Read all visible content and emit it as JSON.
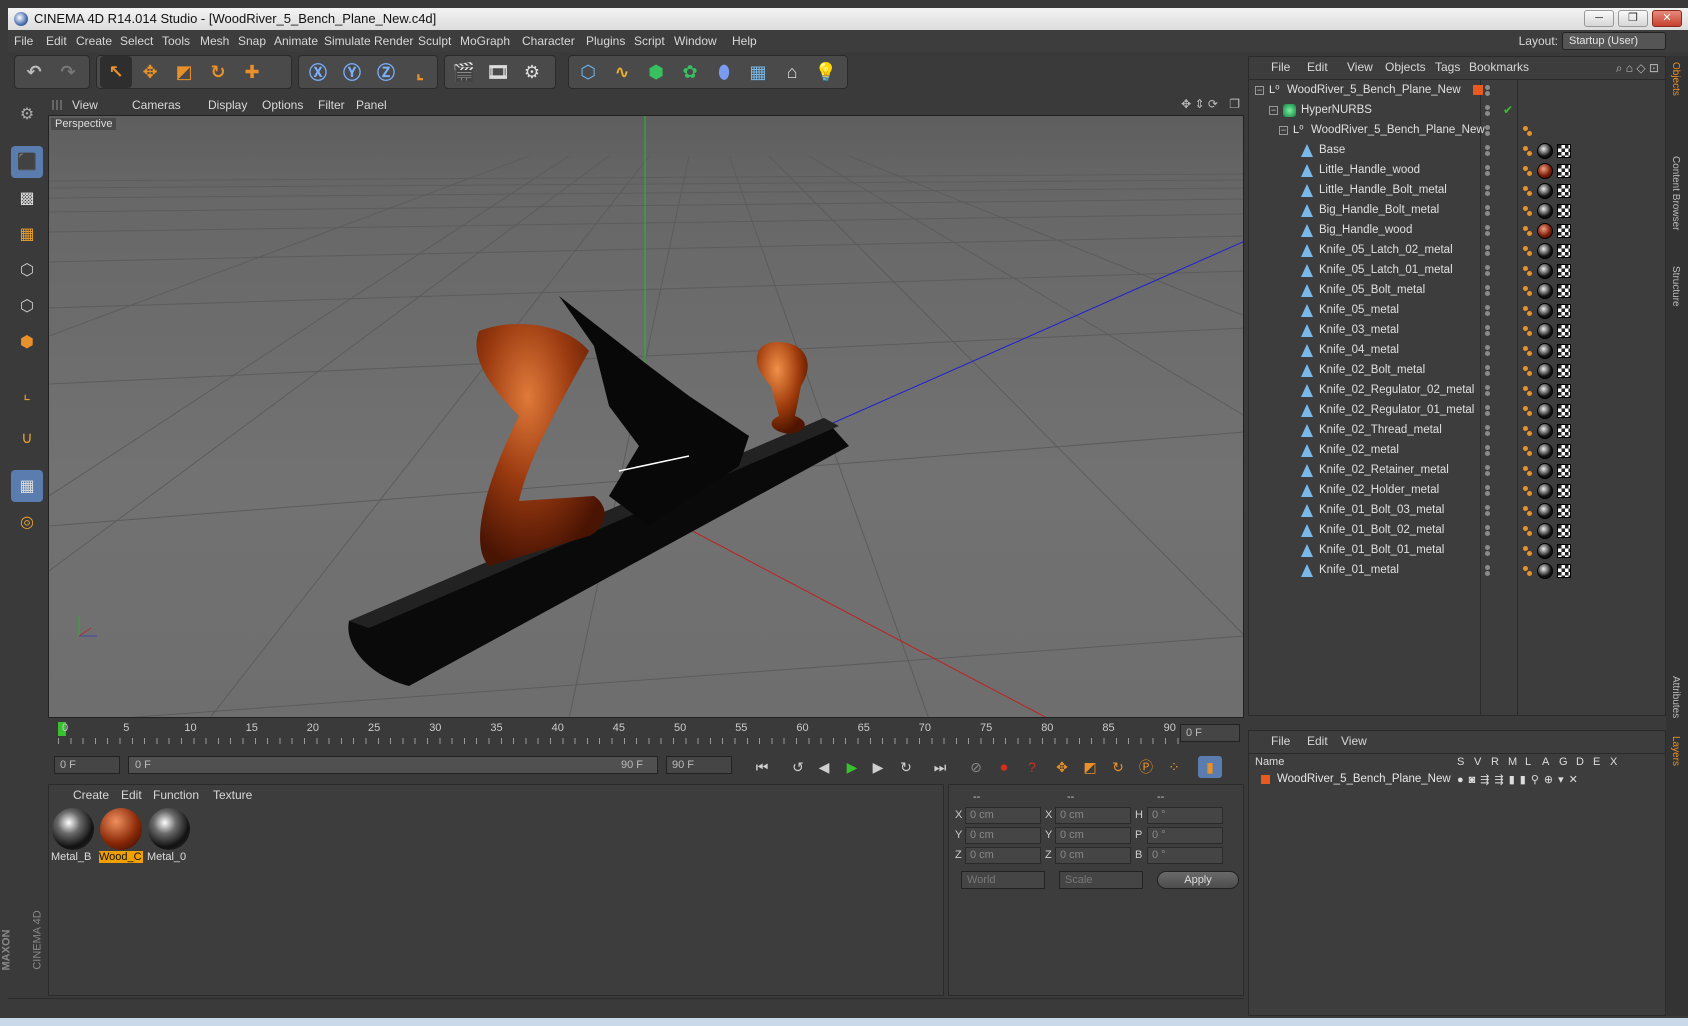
{
  "window": {
    "title": "CINEMA 4D R14.014 Studio - [WoodRiver_5_Bench_Plane_New.c4d]",
    "min": "─",
    "restore": "❐",
    "close": "✕"
  },
  "menubar": {
    "items": [
      "File",
      "Edit",
      "Create",
      "Select",
      "Tools",
      "Mesh",
      "Snap",
      "Animate",
      "Simulate",
      "Render",
      "Sculpt",
      "MoGraph",
      "Character",
      "Plugins",
      "Script",
      "Window",
      "Help"
    ],
    "layout_label": "Layout:",
    "layout_value": "Startup (User)"
  },
  "viewport": {
    "menu": [
      "View",
      "Cameras",
      "Display",
      "Options",
      "Filter",
      "Panel"
    ],
    "label": "Perspective"
  },
  "timeline": {
    "ticks": [
      "0",
      "5",
      "10",
      "15",
      "20",
      "25",
      "30",
      "35",
      "40",
      "45",
      "50",
      "55",
      "60",
      "65",
      "70",
      "75",
      "80",
      "85",
      "90"
    ],
    "current_frame": "0 F"
  },
  "transport": {
    "start": "0 F",
    "range_start": "0 F",
    "range_end": "90 F",
    "end": "90 F"
  },
  "materials": {
    "menu": [
      "Create",
      "Edit",
      "Function",
      "Texture"
    ],
    "items": [
      {
        "label": "Metal_B",
        "kind": "metal"
      },
      {
        "label": "Wood_C",
        "kind": "wood",
        "selected": true
      },
      {
        "label": "Metal_0",
        "kind": "metal"
      }
    ]
  },
  "coords": {
    "headers": [
      "--",
      "--",
      "--"
    ],
    "rows": [
      {
        "a": "X",
        "av": "0 cm",
        "b": "X",
        "bv": "0 cm",
        "c": "H",
        "cv": "0 °"
      },
      {
        "a": "Y",
        "av": "0 cm",
        "b": "Y",
        "bv": "0 cm",
        "c": "P",
        "cv": "0 °"
      },
      {
        "a": "Z",
        "av": "0 cm",
        "b": "Z",
        "bv": "0 cm",
        "c": "B",
        "cv": "0 °"
      }
    ],
    "world": "World",
    "scale": "Scale",
    "apply": "Apply"
  },
  "objects": {
    "menu": [
      "File",
      "Edit",
      "View",
      "Objects",
      "Tags",
      "Bookmarks"
    ],
    "items": [
      {
        "name": "WoodRiver_5_Bench_Plane_New",
        "indent": 0,
        "kind": "null"
      },
      {
        "name": "HyperNURBS",
        "indent": 1,
        "kind": "hnurbs"
      },
      {
        "name": "WoodRiver_5_Bench_Plane_New",
        "indent": 2,
        "kind": "null"
      },
      {
        "name": "Base",
        "indent": 3,
        "kind": "poly",
        "mat": "metal"
      },
      {
        "name": "Little_Handle_wood",
        "indent": 3,
        "kind": "poly",
        "mat": "wood"
      },
      {
        "name": "Little_Handle_Bolt_metal",
        "indent": 3,
        "kind": "poly",
        "mat": "metal"
      },
      {
        "name": "Big_Handle_Bolt_metal",
        "indent": 3,
        "kind": "poly",
        "mat": "metal"
      },
      {
        "name": "Big_Handle_wood",
        "indent": 3,
        "kind": "poly",
        "mat": "wood"
      },
      {
        "name": "Knife_05_Latch_02_metal",
        "indent": 3,
        "kind": "poly",
        "mat": "metal"
      },
      {
        "name": "Knife_05_Latch_01_metal",
        "indent": 3,
        "kind": "poly",
        "mat": "metal"
      },
      {
        "name": "Knife_05_Bolt_metal",
        "indent": 3,
        "kind": "poly",
        "mat": "metal"
      },
      {
        "name": "Knife_05_metal",
        "indent": 3,
        "kind": "poly",
        "mat": "metal"
      },
      {
        "name": "Knife_03_metal",
        "indent": 3,
        "kind": "poly",
        "mat": "metal"
      },
      {
        "name": "Knife_04_metal",
        "indent": 3,
        "kind": "poly",
        "mat": "metal"
      },
      {
        "name": "Knife_02_Bolt_metal",
        "indent": 3,
        "kind": "poly",
        "mat": "metal"
      },
      {
        "name": "Knife_02_Regulator_02_metal",
        "indent": 3,
        "kind": "poly",
        "mat": "metal"
      },
      {
        "name": "Knife_02_Regulator_01_metal",
        "indent": 3,
        "kind": "poly",
        "mat": "metal"
      },
      {
        "name": "Knife_02_Thread_metal",
        "indent": 3,
        "kind": "poly",
        "mat": "metal"
      },
      {
        "name": "Knife_02_metal",
        "indent": 3,
        "kind": "poly",
        "mat": "metal"
      },
      {
        "name": "Knife_02_Retainer_metal",
        "indent": 3,
        "kind": "poly",
        "mat": "metal"
      },
      {
        "name": "Knife_02_Holder_metal",
        "indent": 3,
        "kind": "poly",
        "mat": "metal"
      },
      {
        "name": "Knife_01_Bolt_03_metal",
        "indent": 3,
        "kind": "poly",
        "mat": "metal"
      },
      {
        "name": "Knife_01_Bolt_02_metal",
        "indent": 3,
        "kind": "poly",
        "mat": "metal"
      },
      {
        "name": "Knife_01_Bolt_01_metal",
        "indent": 3,
        "kind": "poly",
        "mat": "metal"
      },
      {
        "name": "Knife_01_metal",
        "indent": 3,
        "kind": "poly",
        "mat": "metal"
      }
    ]
  },
  "layers": {
    "menu": [
      "File",
      "Edit",
      "View"
    ],
    "col_name": "Name",
    "cols": [
      "S",
      "V",
      "R",
      "M",
      "L",
      "A",
      "G",
      "D",
      "E",
      "X"
    ],
    "row": "WoodRiver_5_Bench_Plane_New"
  },
  "sidetabs": [
    "Objects",
    "Content Browser",
    "Structure",
    "Attributes",
    "Layers"
  ],
  "branding": {
    "maxon": "MAXON",
    "cinema": "CINEMA 4D"
  },
  "colors": {
    "accent": "#e8902a",
    "selected_mat": "#f0a000",
    "play_green": "#38c030"
  }
}
